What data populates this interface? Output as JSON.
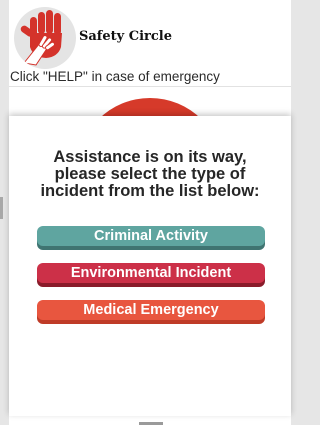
{
  "header": {
    "app_title": "Safety Circle",
    "hint": "Click \"HELP\" in case of emergency",
    "logo_icon": "helping-hands-icon"
  },
  "message": {
    "lines": [
      "Assistance is on its way,",
      "please select the type of",
      "incident from the list below:"
    ]
  },
  "incidents": [
    {
      "label": "Criminal Activity",
      "color": "#5fa5a0"
    },
    {
      "label": "Environmental Incident",
      "color": "#cc3048"
    },
    {
      "label": "Medical Emergency",
      "color": "#e8563f"
    }
  ],
  "colors": {
    "help_button": "#d63a2a",
    "logo_hand": "#d4332b"
  }
}
